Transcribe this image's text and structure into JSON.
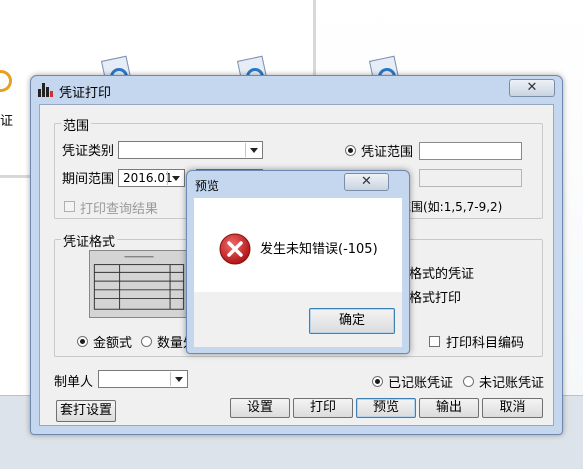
{
  "background": {
    "edge_char": "证"
  },
  "dialog": {
    "title": "凭证打印",
    "close_glyph": "✕",
    "range_group": {
      "legend": "范围",
      "voucher_type_label": "凭证类别",
      "voucher_type_value": "",
      "period_label": "期间范围",
      "period_value": "2016.01",
      "print_query_result": "打印查询结果",
      "voucher_range_radio": "凭证范围",
      "voucher_range_hint": "范围(如:1,5,7-9,2)"
    },
    "format_group": {
      "legend": "凭证格式",
      "option_format_voucher": "格式的凭证",
      "option_format_print": "格式打印",
      "amount_radio": "金额式",
      "quantity_radio": "数量外",
      "print_subject_code": "打印科目编码"
    },
    "maker_label": "制单人",
    "maker_value": "",
    "posted_radio": "已记账凭证",
    "unposted_radio": "未记账凭证",
    "buttons": {
      "template_setup": "套打设置",
      "settings": "设置",
      "print": "打印",
      "preview": "预览",
      "export": "输出",
      "cancel": "取消"
    }
  },
  "error_popup": {
    "title": "预览",
    "close_glyph": "✕",
    "message": "发生未知错误(-105)",
    "ok_button": "确定",
    "icon": "error-icon"
  }
}
